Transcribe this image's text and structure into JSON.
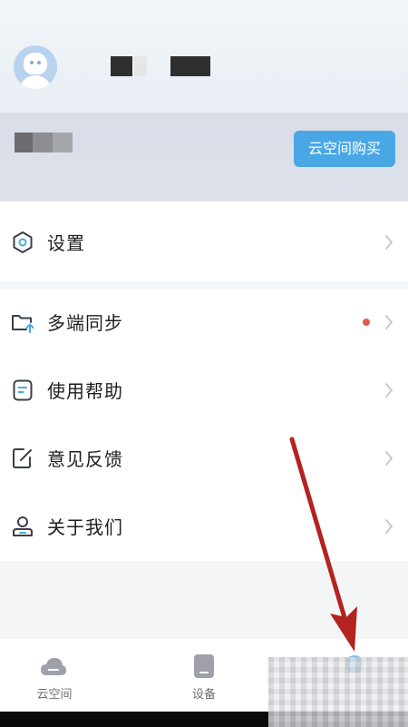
{
  "header": {
    "avatar_icon": "default-user-avatar"
  },
  "cloud": {
    "buy_label": "云空间购买"
  },
  "menu": {
    "settings": {
      "label": "设置",
      "icon": "settings-hexagon-icon"
    },
    "items": [
      {
        "label": "多端同步",
        "icon": "folder-upload-icon",
        "badge": "red-dot"
      },
      {
        "label": "使用帮助",
        "icon": "help-doc-icon"
      },
      {
        "label": "意见反馈",
        "icon": "feedback-edit-icon"
      },
      {
        "label": "关于我们",
        "icon": "person-icon"
      }
    ]
  },
  "tabbar": {
    "tabs": [
      {
        "label": "云空间",
        "icon": "cloud-icon"
      },
      {
        "label": "设备",
        "icon": "device-icon"
      }
    ]
  },
  "colors": {
    "accent": "#4aa7e6",
    "badge": "#e25a4f",
    "arrow": "#b3231f"
  }
}
